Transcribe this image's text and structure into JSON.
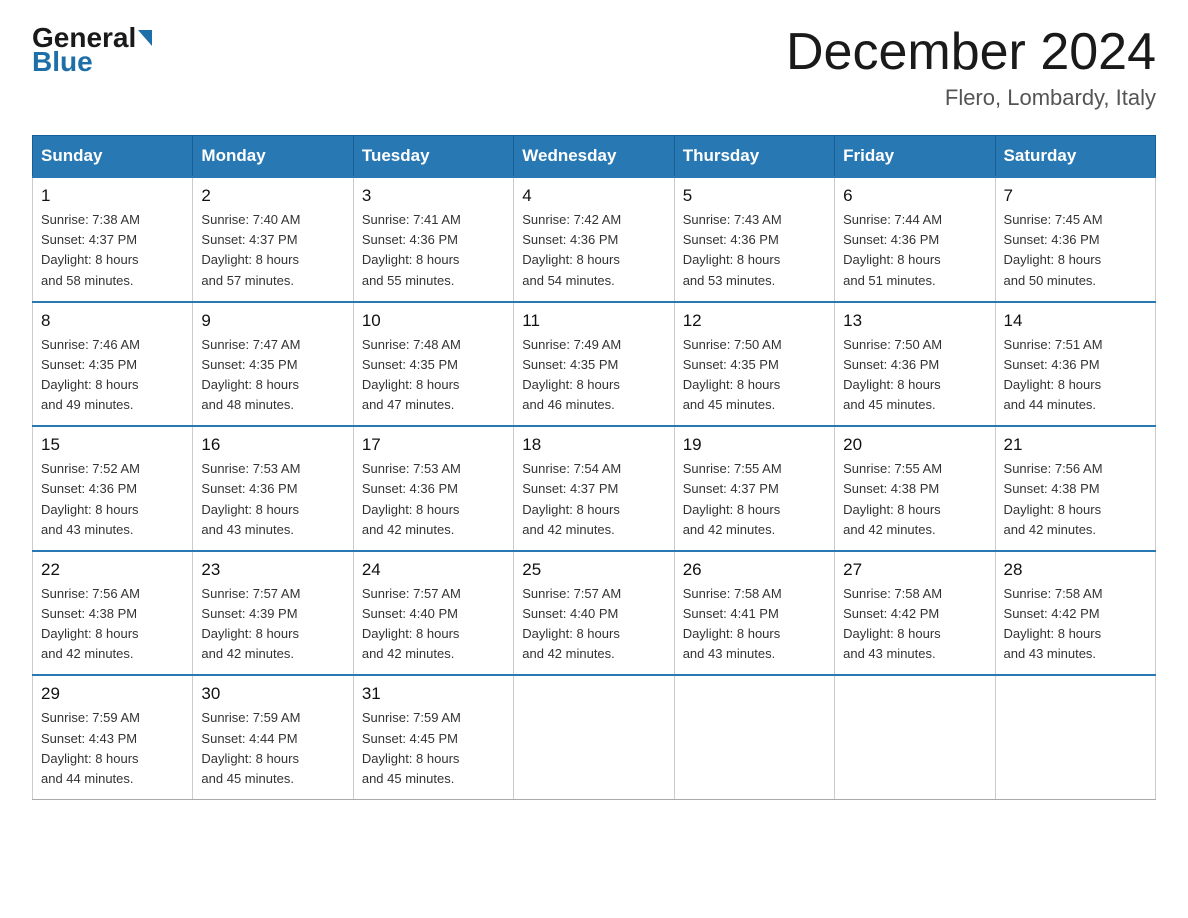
{
  "header": {
    "logo_line1": "General",
    "logo_line2": "Blue",
    "month_title": "December 2024",
    "location": "Flero, Lombardy, Italy"
  },
  "days_of_week": [
    "Sunday",
    "Monday",
    "Tuesday",
    "Wednesday",
    "Thursday",
    "Friday",
    "Saturday"
  ],
  "weeks": [
    [
      {
        "day": "1",
        "sunrise": "7:38 AM",
        "sunset": "4:37 PM",
        "daylight": "8 hours and 58 minutes."
      },
      {
        "day": "2",
        "sunrise": "7:40 AM",
        "sunset": "4:37 PM",
        "daylight": "8 hours and 57 minutes."
      },
      {
        "day": "3",
        "sunrise": "7:41 AM",
        "sunset": "4:36 PM",
        "daylight": "8 hours and 55 minutes."
      },
      {
        "day": "4",
        "sunrise": "7:42 AM",
        "sunset": "4:36 PM",
        "daylight": "8 hours and 54 minutes."
      },
      {
        "day": "5",
        "sunrise": "7:43 AM",
        "sunset": "4:36 PM",
        "daylight": "8 hours and 53 minutes."
      },
      {
        "day": "6",
        "sunrise": "7:44 AM",
        "sunset": "4:36 PM",
        "daylight": "8 hours and 51 minutes."
      },
      {
        "day": "7",
        "sunrise": "7:45 AM",
        "sunset": "4:36 PM",
        "daylight": "8 hours and 50 minutes."
      }
    ],
    [
      {
        "day": "8",
        "sunrise": "7:46 AM",
        "sunset": "4:35 PM",
        "daylight": "8 hours and 49 minutes."
      },
      {
        "day": "9",
        "sunrise": "7:47 AM",
        "sunset": "4:35 PM",
        "daylight": "8 hours and 48 minutes."
      },
      {
        "day": "10",
        "sunrise": "7:48 AM",
        "sunset": "4:35 PM",
        "daylight": "8 hours and 47 minutes."
      },
      {
        "day": "11",
        "sunrise": "7:49 AM",
        "sunset": "4:35 PM",
        "daylight": "8 hours and 46 minutes."
      },
      {
        "day": "12",
        "sunrise": "7:50 AM",
        "sunset": "4:35 PM",
        "daylight": "8 hours and 45 minutes."
      },
      {
        "day": "13",
        "sunrise": "7:50 AM",
        "sunset": "4:36 PM",
        "daylight": "8 hours and 45 minutes."
      },
      {
        "day": "14",
        "sunrise": "7:51 AM",
        "sunset": "4:36 PM",
        "daylight": "8 hours and 44 minutes."
      }
    ],
    [
      {
        "day": "15",
        "sunrise": "7:52 AM",
        "sunset": "4:36 PM",
        "daylight": "8 hours and 43 minutes."
      },
      {
        "day": "16",
        "sunrise": "7:53 AM",
        "sunset": "4:36 PM",
        "daylight": "8 hours and 43 minutes."
      },
      {
        "day": "17",
        "sunrise": "7:53 AM",
        "sunset": "4:36 PM",
        "daylight": "8 hours and 42 minutes."
      },
      {
        "day": "18",
        "sunrise": "7:54 AM",
        "sunset": "4:37 PM",
        "daylight": "8 hours and 42 minutes."
      },
      {
        "day": "19",
        "sunrise": "7:55 AM",
        "sunset": "4:37 PM",
        "daylight": "8 hours and 42 minutes."
      },
      {
        "day": "20",
        "sunrise": "7:55 AM",
        "sunset": "4:38 PM",
        "daylight": "8 hours and 42 minutes."
      },
      {
        "day": "21",
        "sunrise": "7:56 AM",
        "sunset": "4:38 PM",
        "daylight": "8 hours and 42 minutes."
      }
    ],
    [
      {
        "day": "22",
        "sunrise": "7:56 AM",
        "sunset": "4:38 PM",
        "daylight": "8 hours and 42 minutes."
      },
      {
        "day": "23",
        "sunrise": "7:57 AM",
        "sunset": "4:39 PM",
        "daylight": "8 hours and 42 minutes."
      },
      {
        "day": "24",
        "sunrise": "7:57 AM",
        "sunset": "4:40 PM",
        "daylight": "8 hours and 42 minutes."
      },
      {
        "day": "25",
        "sunrise": "7:57 AM",
        "sunset": "4:40 PM",
        "daylight": "8 hours and 42 minutes."
      },
      {
        "day": "26",
        "sunrise": "7:58 AM",
        "sunset": "4:41 PM",
        "daylight": "8 hours and 43 minutes."
      },
      {
        "day": "27",
        "sunrise": "7:58 AM",
        "sunset": "4:42 PM",
        "daylight": "8 hours and 43 minutes."
      },
      {
        "day": "28",
        "sunrise": "7:58 AM",
        "sunset": "4:42 PM",
        "daylight": "8 hours and 43 minutes."
      }
    ],
    [
      {
        "day": "29",
        "sunrise": "7:59 AM",
        "sunset": "4:43 PM",
        "daylight": "8 hours and 44 minutes."
      },
      {
        "day": "30",
        "sunrise": "7:59 AM",
        "sunset": "4:44 PM",
        "daylight": "8 hours and 45 minutes."
      },
      {
        "day": "31",
        "sunrise": "7:59 AM",
        "sunset": "4:45 PM",
        "daylight": "8 hours and 45 minutes."
      },
      null,
      null,
      null,
      null
    ]
  ],
  "labels": {
    "sunrise": "Sunrise: ",
    "sunset": "Sunset: ",
    "daylight": "Daylight: "
  }
}
